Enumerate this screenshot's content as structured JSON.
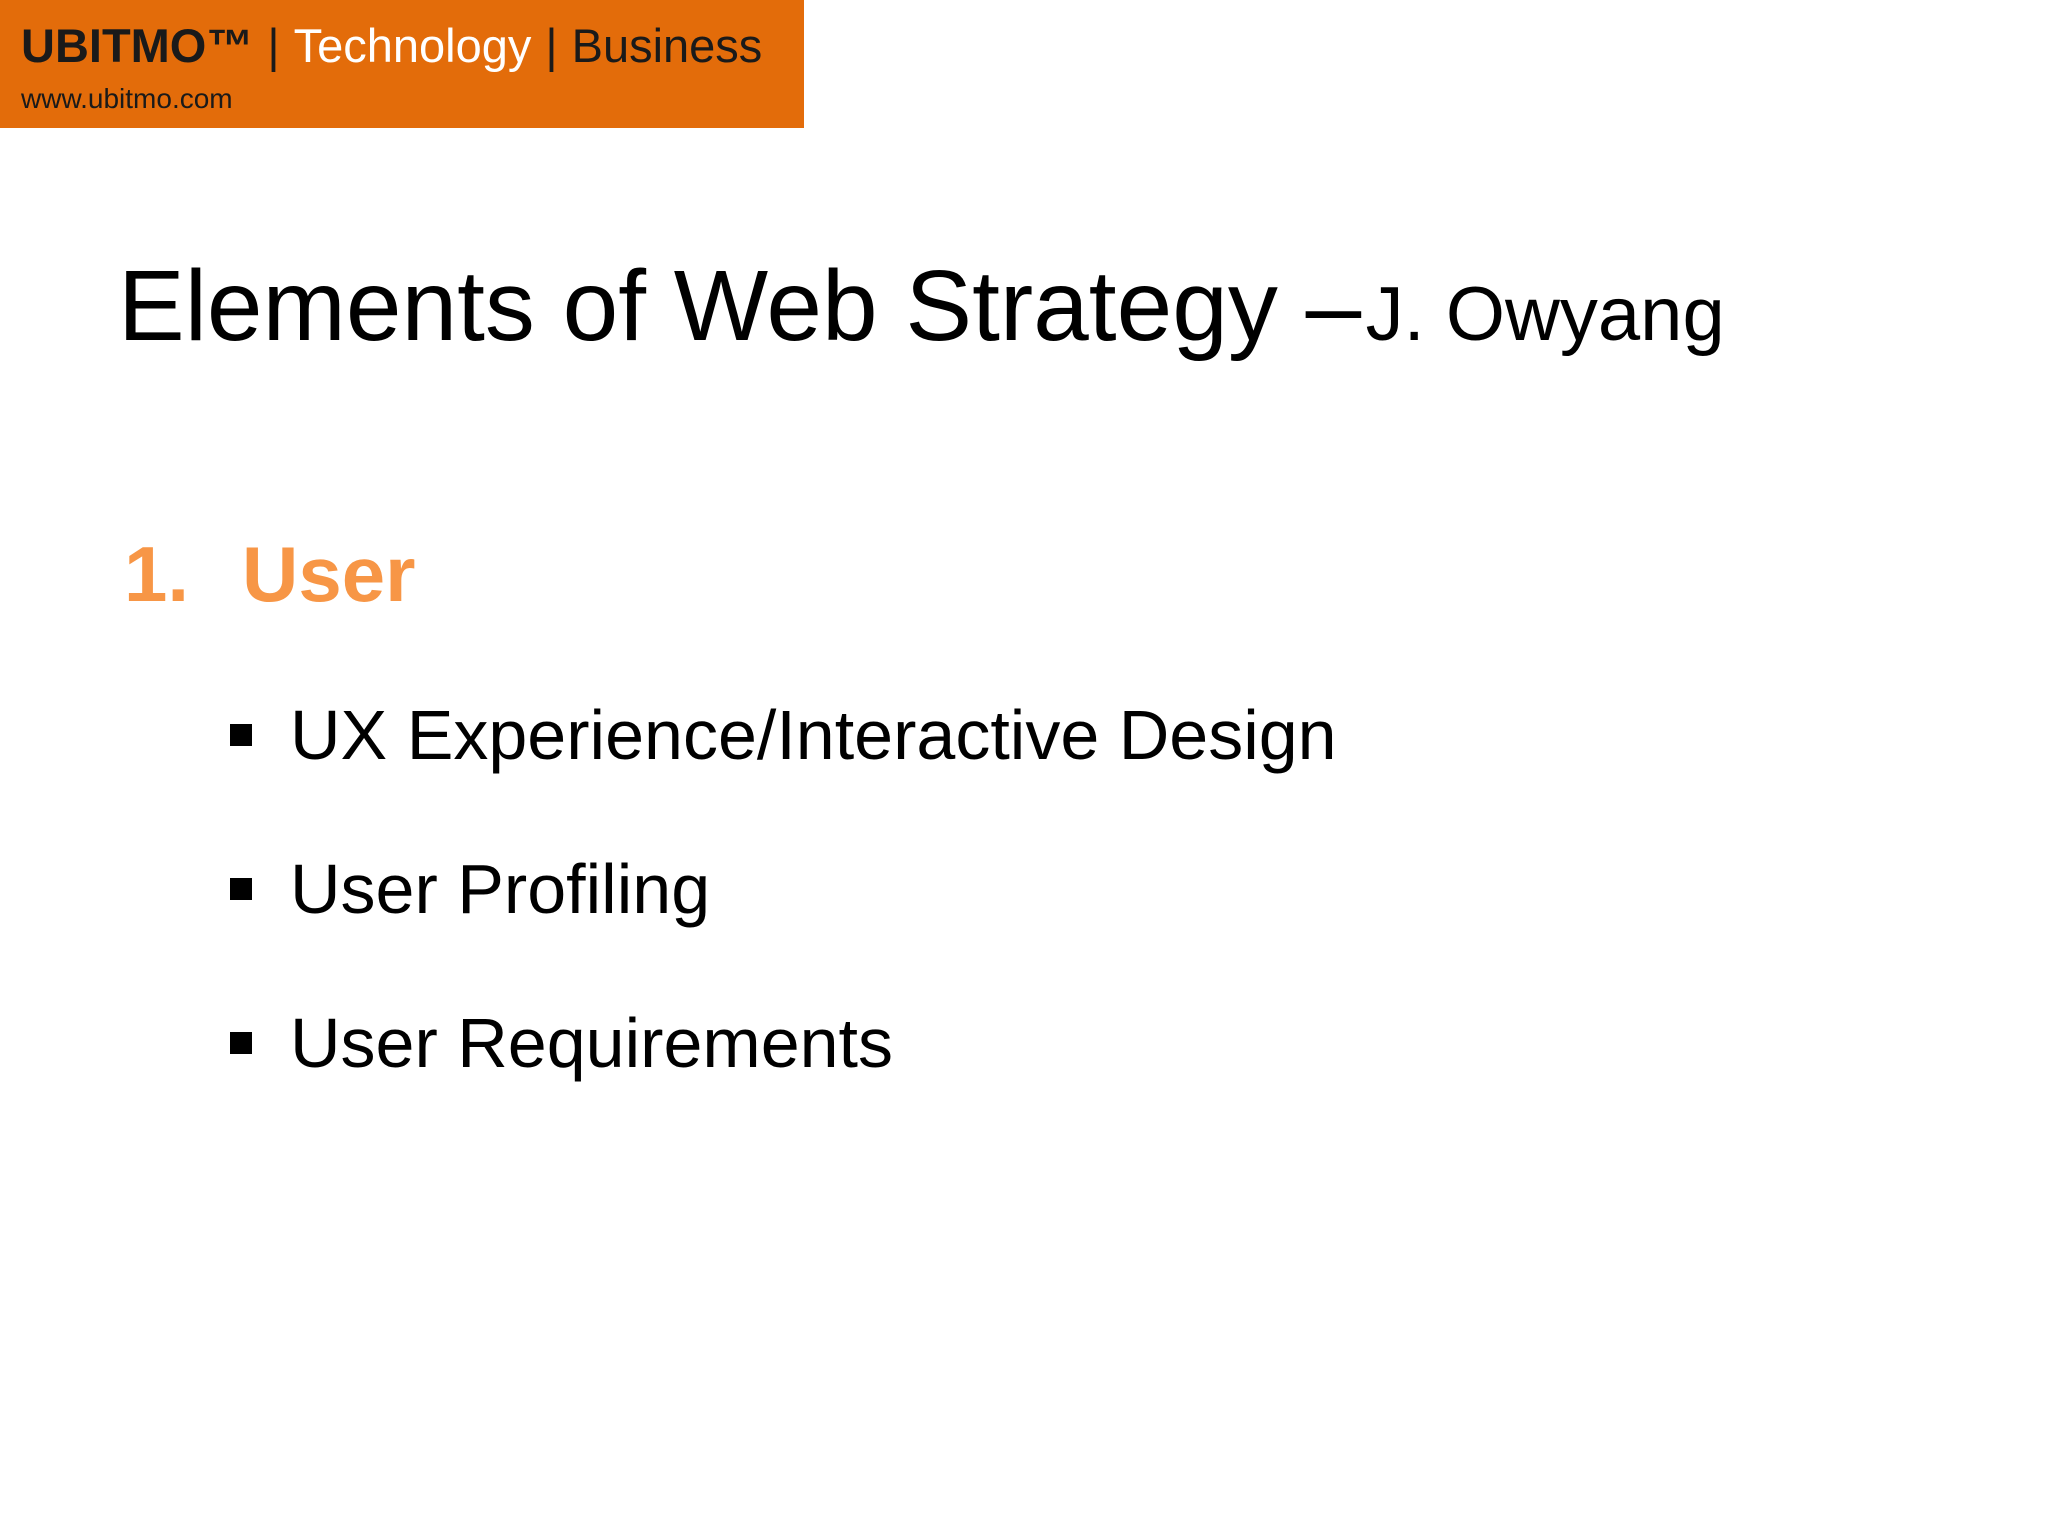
{
  "header": {
    "brand_name": "UBITMO™",
    "separator": "|",
    "technology": "Technology",
    "business": "Business",
    "url": "www.ubitmo.com",
    "accent_color": "#e36c0a"
  },
  "slide": {
    "title_main": "Elements of Web Strategy –",
    "title_author": "J. Owyang",
    "section_number": "1.",
    "section_label": "User",
    "section_color": "#f79646",
    "bullets": [
      "UX Experience/Interactive Design",
      "User Profiling",
      "User Requirements"
    ]
  }
}
